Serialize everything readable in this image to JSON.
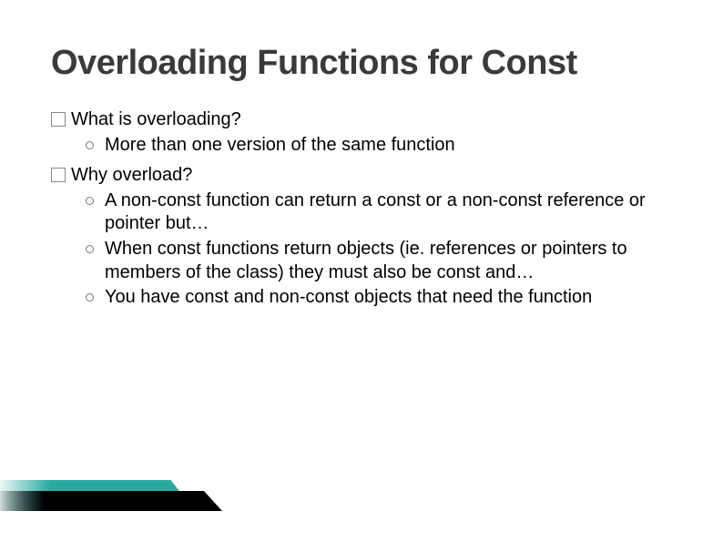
{
  "title": "Overloading Functions for Const",
  "q1": {
    "text": "What is overloading?"
  },
  "q1_sub": {
    "a": "More than one version of the same function"
  },
  "q2": {
    "text": "Why overload?"
  },
  "q2_sub": {
    "a": "A non-const function can return a const or a non-const reference or pointer but…",
    "b": "When const functions return objects (ie. references or pointers to members of the class) they must also be const and…",
    "c": "You have const and non-const objects that need the function"
  }
}
